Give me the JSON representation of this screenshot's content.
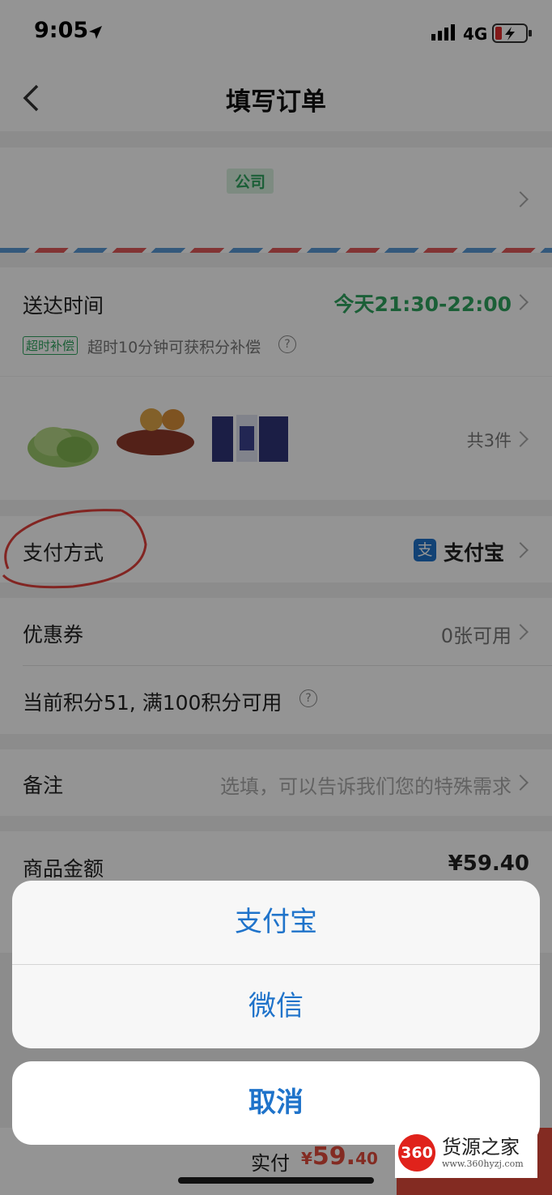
{
  "status": {
    "time": "9:05",
    "network": "4G"
  },
  "nav": {
    "title": "填写订单"
  },
  "address": {
    "tag": "公司"
  },
  "delivery": {
    "label": "送达时间",
    "value": "今天21:30-22:00",
    "badge": "超时补偿",
    "note": "超时10分钟可获积分补偿"
  },
  "items": {
    "count": "共3件"
  },
  "payment": {
    "label": "支付方式",
    "value": "支付宝",
    "icon_text": "支"
  },
  "coupon": {
    "label": "优惠券",
    "value": "0张可用"
  },
  "points": {
    "text": "当前积分51, 满100积分可用"
  },
  "remark": {
    "label": "备注",
    "placeholder": "选填，可以告诉我们您的特殊需求"
  },
  "amount": {
    "label": "商品金额",
    "value": "¥59.40"
  },
  "bottom": {
    "pay_label": "实付",
    "currency": "¥",
    "price_int": "59.",
    "price_dec": "40"
  },
  "sheet": {
    "option1": "支付宝",
    "option2": "微信",
    "cancel": "取消"
  },
  "watermark": {
    "logo": "360",
    "title": "货源之家",
    "url": "www.360hyzj.com"
  },
  "colors": {
    "green": "#2fa45f",
    "blue": "#1f73ca",
    "red": "#e24a3b"
  }
}
